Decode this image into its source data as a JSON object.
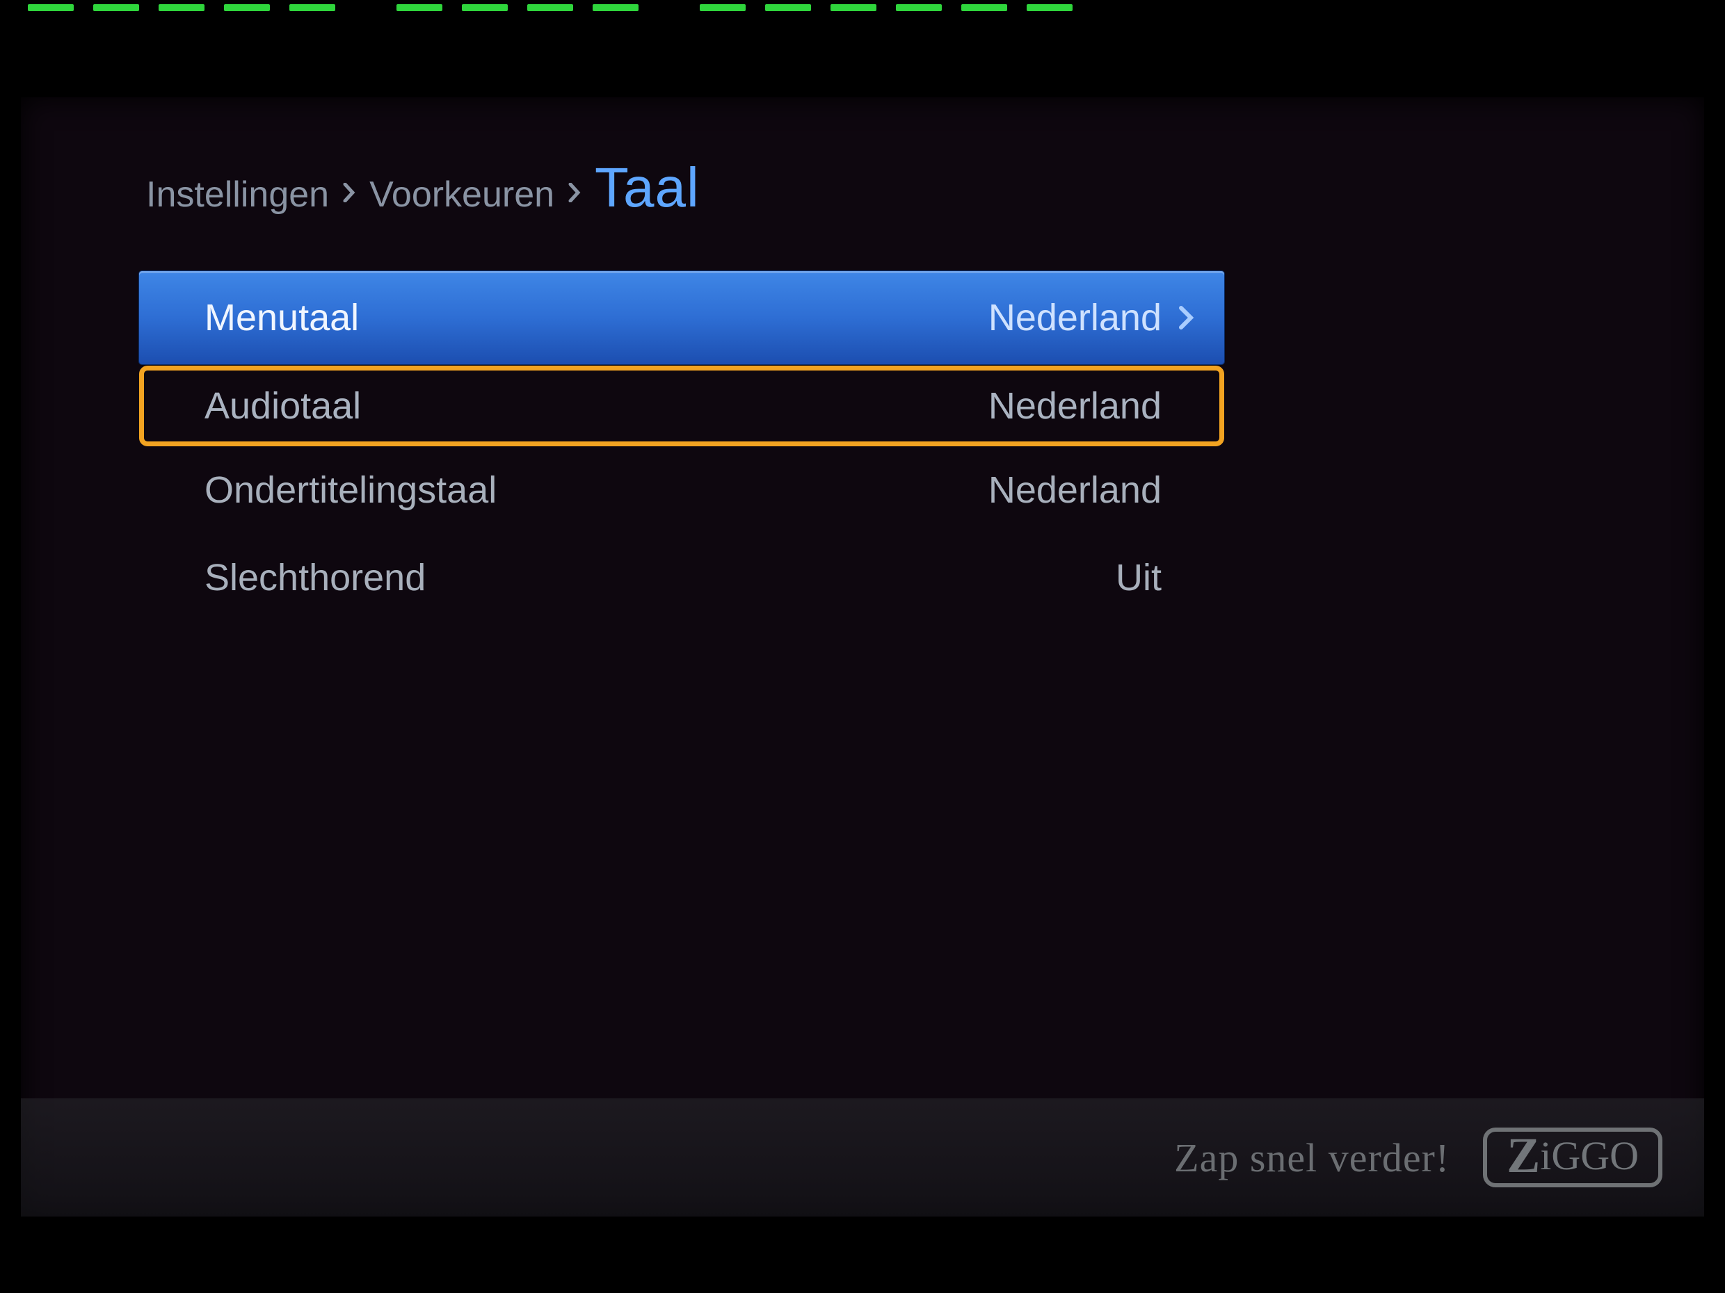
{
  "breadcrumb": {
    "items": [
      "Instellingen",
      "Voorkeuren"
    ],
    "current": "Taal"
  },
  "menu": {
    "items": [
      {
        "label": "Menutaal",
        "value": "Nederland",
        "selected": true,
        "highlighted": false
      },
      {
        "label": "Audiotaal",
        "value": "Nederland",
        "selected": false,
        "highlighted": true
      },
      {
        "label": "Ondertitelingstaal",
        "value": "Nederland",
        "selected": false,
        "highlighted": false
      },
      {
        "label": "Slechthorend",
        "value": "Uit",
        "selected": false,
        "highlighted": false
      }
    ]
  },
  "footer": {
    "text": "Zap snel verder!",
    "brand": "ZiGGO"
  },
  "colors": {
    "accent_green": "#2fd53c",
    "select_blue": "#2e6ed4",
    "highlight_orange": "#f2a321",
    "crumb_blue": "#5ea6ff"
  }
}
